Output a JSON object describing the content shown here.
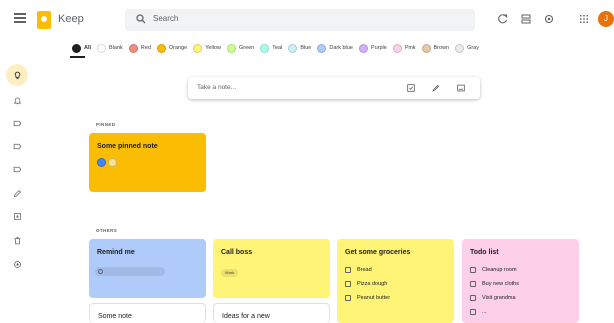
{
  "header": {
    "app_title": "Keep",
    "search_placeholder": "Search",
    "avatar_letter": "J"
  },
  "filters": [
    {
      "label": "All",
      "color": "#202124",
      "active": true
    },
    {
      "label": "Blank",
      "color": "#ffffff"
    },
    {
      "label": "Red",
      "color": "#f28b82"
    },
    {
      "label": "Orange",
      "color": "#fbbc04"
    },
    {
      "label": "Yellow",
      "color": "#fff475"
    },
    {
      "label": "Green",
      "color": "#ccff90"
    },
    {
      "label": "Teal",
      "color": "#a7ffeb"
    },
    {
      "label": "Blue",
      "color": "#cbf0f8"
    },
    {
      "label": "Dark blue",
      "color": "#aecbfa"
    },
    {
      "label": "Purple",
      "color": "#d7aefb"
    },
    {
      "label": "Pink",
      "color": "#fdcfe8"
    },
    {
      "label": "Brown",
      "color": "#e6c9a8"
    },
    {
      "label": "Gray",
      "color": "#e8eaed"
    }
  ],
  "sidebar": {
    "items": [
      {
        "icon": "lightbulb-icon",
        "active": true
      },
      {
        "icon": "bell-icon"
      },
      {
        "icon": "label-icon"
      },
      {
        "icon": "label-icon"
      },
      {
        "icon": "label-icon"
      },
      {
        "icon": "pencil-icon"
      },
      {
        "icon": "archive-icon"
      },
      {
        "icon": "trash-icon"
      },
      {
        "icon": "settings-icon"
      }
    ]
  },
  "take_note": {
    "placeholder": "Take a note..."
  },
  "sections": {
    "pinned": "PINNED",
    "others": "OTHERS"
  },
  "notes": {
    "pinned": {
      "title": "Some pinned note",
      "color": "#fbbc04"
    },
    "remind": {
      "title": "Remind me",
      "color": "#aecbfa"
    },
    "call_boss": {
      "title": "Call boss",
      "tag": "Work",
      "color": "#fff475"
    },
    "groceries": {
      "title": "Get some groceries",
      "items": [
        "Bread",
        "Pizza dough",
        "Peanut butter"
      ],
      "color": "#fff475"
    },
    "todo": {
      "title": "Todo list",
      "items": [
        "Cleanup room",
        "Buy new cloths",
        "Visit grandma",
        "..."
      ],
      "color": "#fdcfe8"
    },
    "some_note": {
      "title": "Some note"
    },
    "ideas": {
      "title": "Ideas for a new"
    }
  }
}
